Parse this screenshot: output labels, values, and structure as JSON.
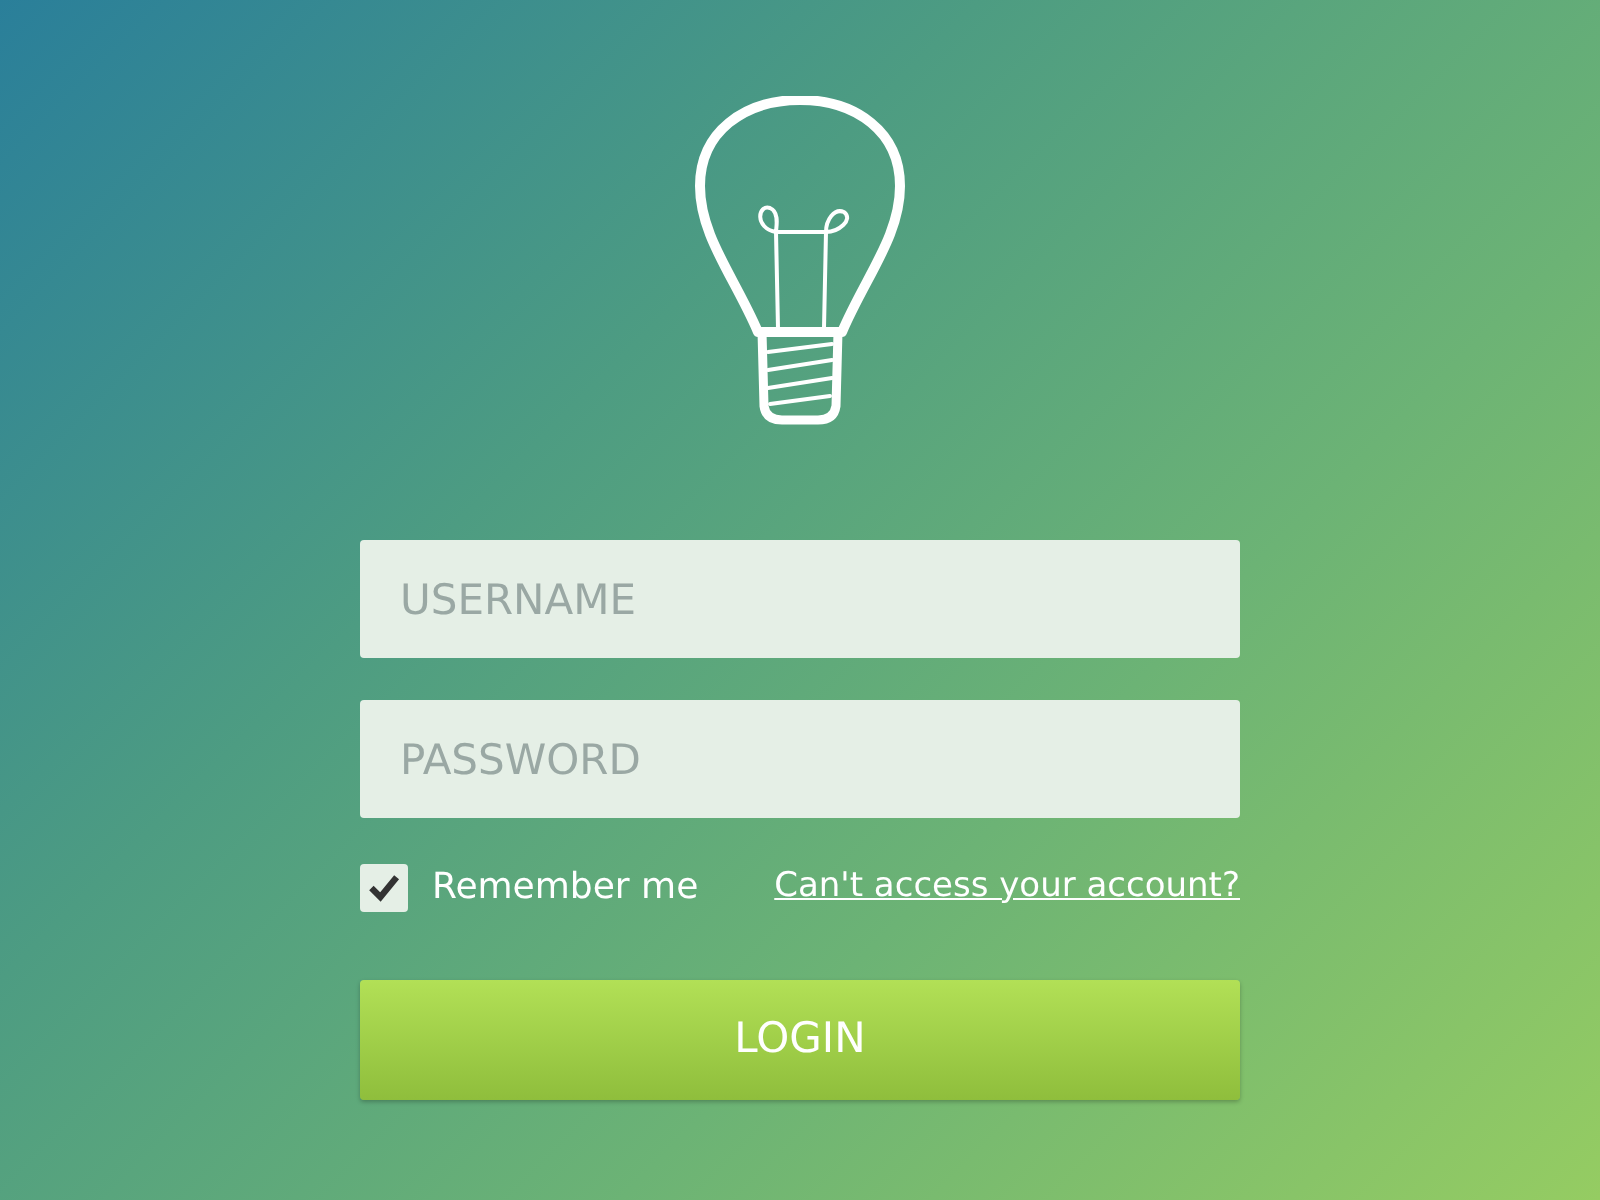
{
  "username": {
    "placeholder": "USERNAME"
  },
  "password": {
    "placeholder": "PASSWORD"
  },
  "remember": {
    "label": "Remember me",
    "checked": true
  },
  "forgot_link": "Can't access your account?",
  "login_button": "LOGIN"
}
